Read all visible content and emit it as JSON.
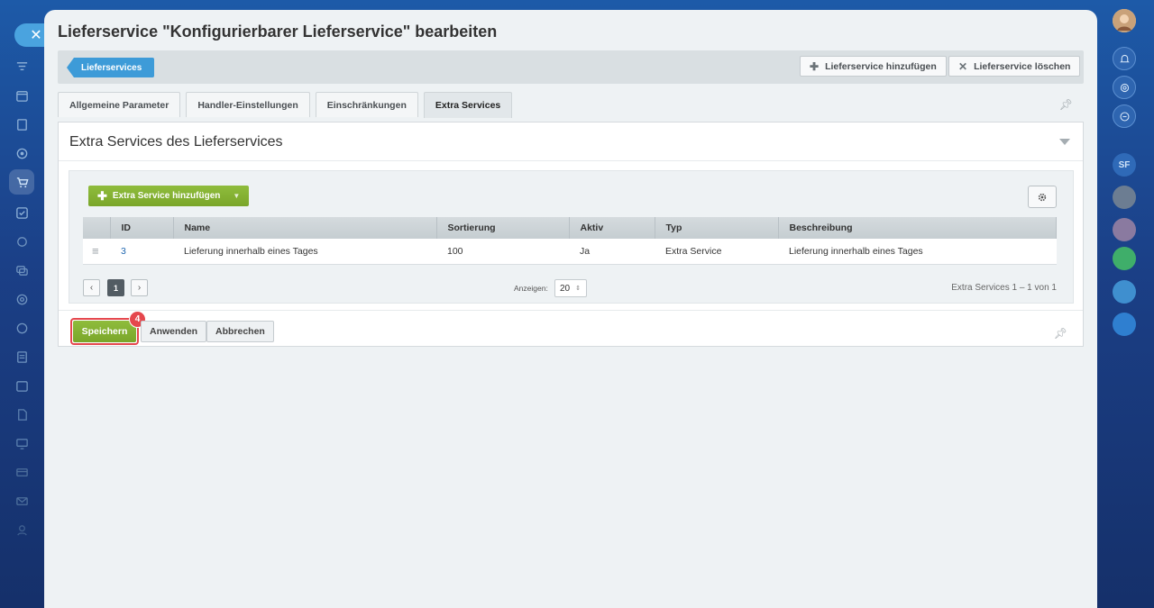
{
  "page": {
    "title": "Lieferservice \"Konfigurierbarer Lieferservice\" bearbeiten",
    "breadcrumb": "Lieferservices"
  },
  "toolbar": {
    "add_label": "Lieferservice hinzufügen",
    "delete_label": "Lieferservice löschen"
  },
  "tabs": [
    {
      "label": "Allgemeine Parameter"
    },
    {
      "label": "Handler-Einstellungen"
    },
    {
      "label": "Einschränkungen"
    },
    {
      "label": "Extra Services"
    }
  ],
  "active_tab": "Extra Services",
  "section": {
    "title": "Extra Services des Lieferservices"
  },
  "grid": {
    "add_button": "Extra Service hinzufügen",
    "columns": [
      "ID",
      "Name",
      "Sortierung",
      "Aktiv",
      "Typ",
      "Beschreibung"
    ],
    "rows": [
      {
        "id": "3",
        "name": "Lieferung innerhalb eines Tages",
        "sort": "100",
        "active": "Ja",
        "type": "Extra Service",
        "description": "Lieferung innerhalb eines Tages"
      }
    ]
  },
  "pager": {
    "current_page": "1",
    "show_label": "Anzeigen:",
    "page_size": "20",
    "range_text": "Extra Services 1 – 1 von 1"
  },
  "actions": {
    "save": "Speichern",
    "apply": "Anwenden",
    "cancel": "Abbrechen",
    "step_badge": "4"
  },
  "colors": {
    "accent_blue": "#3d9bd8",
    "primary_green": "#82af31",
    "highlight_red": "#e5474d"
  },
  "right_rail": {
    "sf_label": "SF"
  }
}
